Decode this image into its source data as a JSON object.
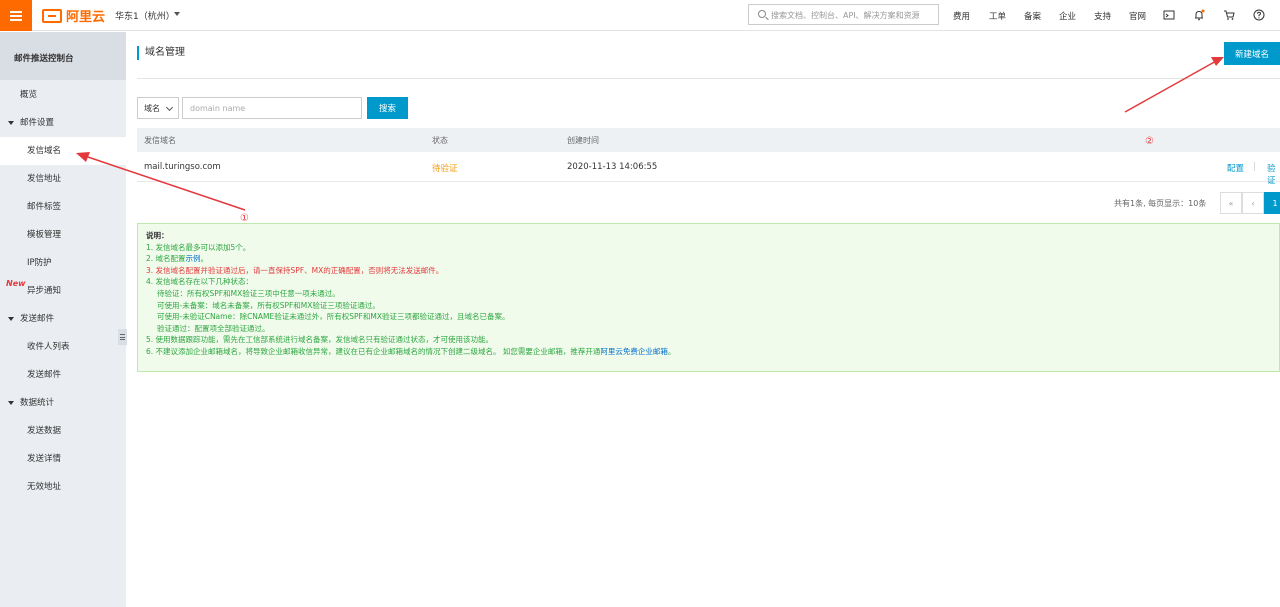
{
  "topbar": {
    "logo_text": "阿里云",
    "region": "华东1（杭州）",
    "search_placeholder": "搜索文档、控制台、API、解决方案和资源",
    "links": [
      "费用",
      "工单",
      "备案",
      "企业",
      "支持",
      "官网"
    ]
  },
  "sidebar": {
    "title": "邮件推送控制台",
    "overview": "概览",
    "new_badge": "New",
    "groups": [
      {
        "label": "邮件设置",
        "items": [
          "发信域名",
          "发信地址",
          "邮件标签",
          "模板管理",
          "IP防护",
          "异步通知"
        ]
      },
      {
        "label": "发送邮件",
        "items": [
          "收件人列表",
          "发送邮件"
        ]
      },
      {
        "label": "数据统计",
        "items": [
          "发送数据",
          "发送详情",
          "无效地址"
        ]
      }
    ],
    "active_item": "发信域名"
  },
  "main": {
    "title": "域名管理",
    "new_button": "新建域名",
    "filter": {
      "select_value": "域名",
      "input_placeholder": "domain name",
      "search_button": "搜索"
    },
    "table": {
      "headers": [
        "发信域名",
        "状态",
        "创建时间"
      ],
      "rows": [
        {
          "domain": "mail.turingso.com",
          "status": "待验证",
          "created": "2020-11-13 14:06:55",
          "actions": [
            "配置",
            "验证"
          ]
        }
      ]
    },
    "pager": {
      "summary": "共有1条, 每页显示：10条",
      "first": "«",
      "prev": "‹",
      "current": "1"
    },
    "notes": {
      "heading": "说明：",
      "line1": "1. 发信域名最多可以添加5个。",
      "line2_prefix": "2. 域名配置",
      "line2_link": "示例",
      "line2_suffix": "。",
      "line3": "3. 发信域名配置并验证通过后，请一直保持SPF、MX的正确配置，否则将无法发送邮件。",
      "line4": "4. 发信域名存在以下几种状态：",
      "line4a": "待验证：所有权SPF和MX验证三项中任意一项未通过。",
      "line4b": "可使用-未备案：域名未备案，所有权SPF和MX验证三项验证通过。",
      "line4c": "可使用-未验证CName：除CNAME验证未通过外，所有权SPF和MX验证三项都验证通过，且域名已备案。",
      "line4d": "验证通过：配置项全部验证通过。",
      "line5": "5. 使用数据跟踪功能，需先在工信部系统进行域名备案，发信域名只有验证通过状态，才可使用该功能。",
      "line6_prefix": "6. 不建议添加企业邮箱域名，将导致企业邮箱收信异常，建议在已有企业邮箱域名的情况下创建二级域名。 如您需要企业邮箱，推荐开通",
      "line6_link": "阿里云免费企业邮箱",
      "line6_suffix": "。"
    }
  },
  "annotations": {
    "marker1": "①",
    "marker2": "②",
    "color": "#e4393c"
  },
  "colors": {
    "brand": "#ff6a00",
    "primary": "#0099cc",
    "pending": "#f39c12",
    "note_green": "#2da641"
  }
}
